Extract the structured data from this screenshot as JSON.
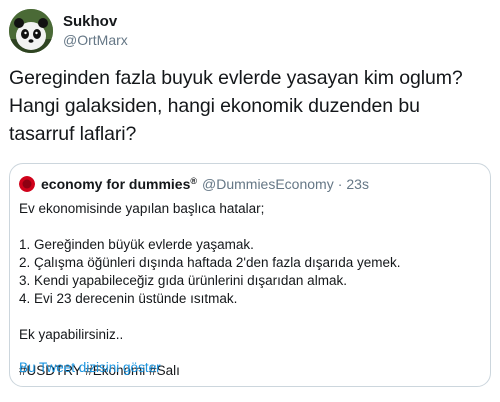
{
  "author": {
    "name": "Sukhov",
    "handle": "@OrtMarx",
    "avatar_icon": "panda-avatar-icon"
  },
  "tweet": {
    "text": "Gereginden fazla buyuk evlerde yasayan kim oglum?\nHangi galaksiden, hangi ekonomik duzenden bu\ntasarruf laflari?"
  },
  "quote": {
    "name": "economy for dummies",
    "registered": "®",
    "handle": "@DummiesEconomy",
    "separator": "·",
    "time": "23s",
    "avatar_icon": "red-circle-avatar-icon",
    "body": "Ev ekonomisinde yapılan başlıca hatalar;\n\n1. Gereğinden büyük evlerde yaşamak.\n2. Çalışma öğünleri dışında haftada 2'den fazla dışarıda yemek.\n3. Kendi yapabileceğiz gıda ürünlerini dışarıdan almak.\n4. Evi 23 derecenin üstünde ısıtmak.\n\nEk yapabilirsiniz..\n\n#USDTRY #Ekonomi #Salı",
    "thread_link": "Bu Tweet dizisini göster"
  },
  "colors": {
    "link": "#1b95e0",
    "secondary_text": "#657786",
    "border": "#ccd6dd"
  }
}
